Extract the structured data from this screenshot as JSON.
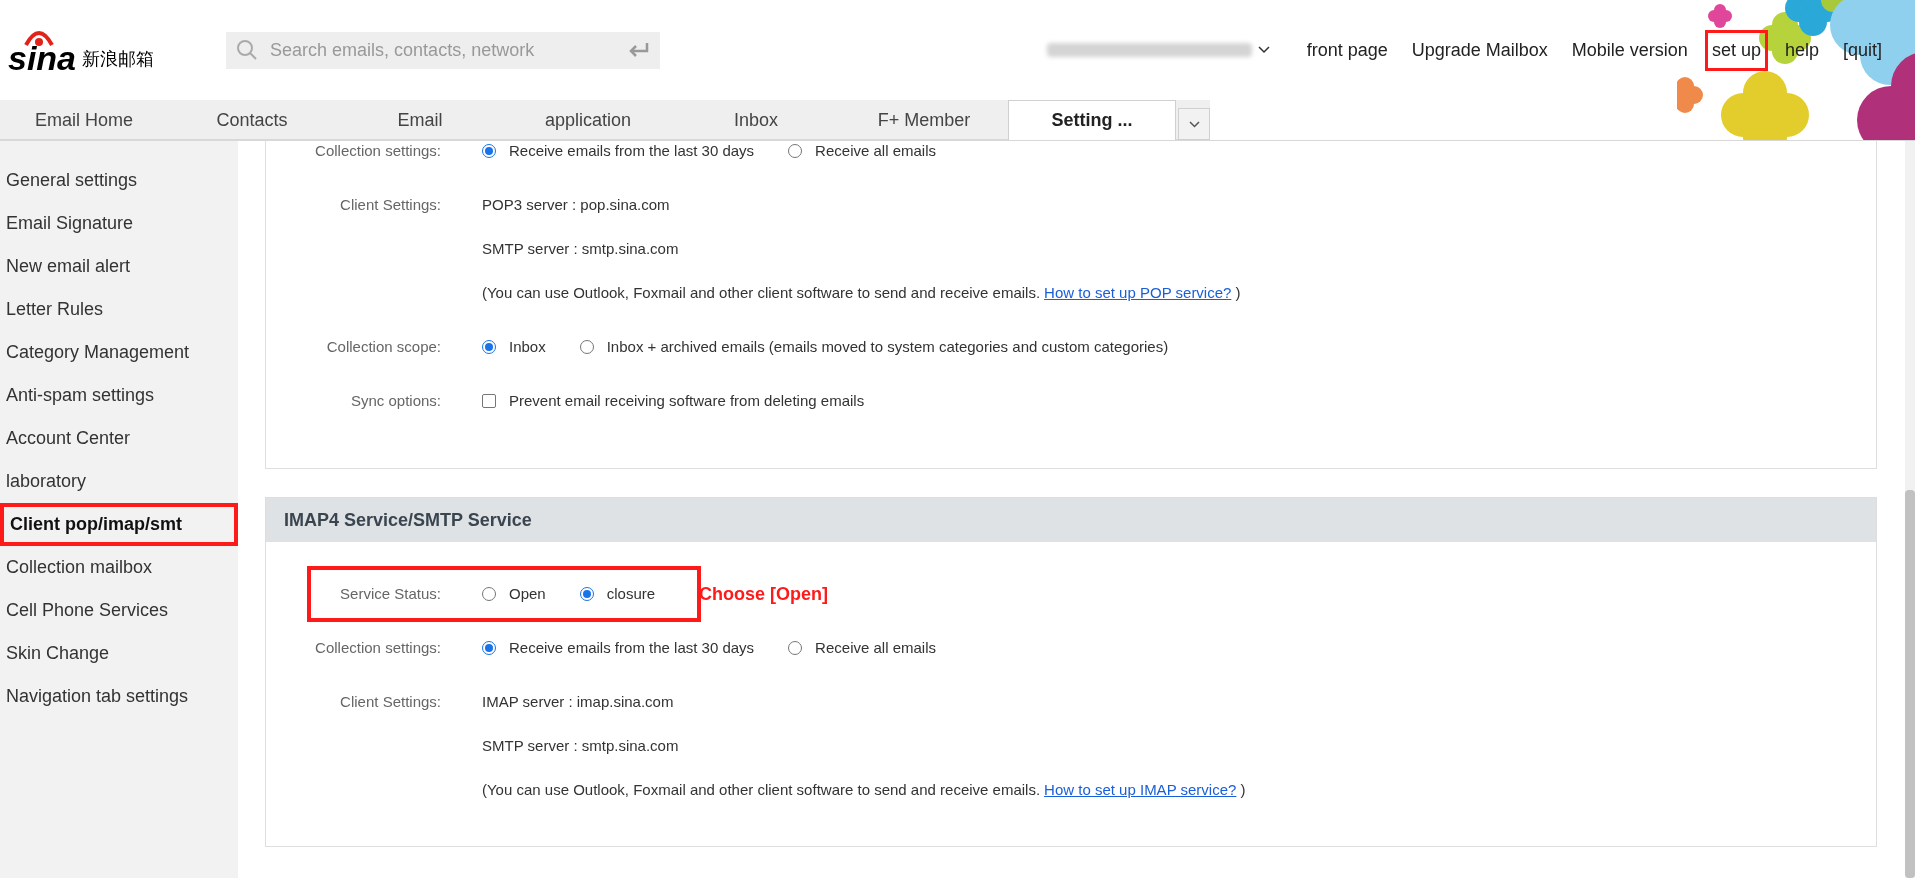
{
  "logo": {
    "wordmark": "sina",
    "name": "新浪邮箱"
  },
  "search": {
    "placeholder": "Search emails, contacts, network"
  },
  "top_links": [
    {
      "label": "front page",
      "highlighted": false
    },
    {
      "label": "Upgrade Mailbox",
      "highlighted": false
    },
    {
      "label": "Mobile version",
      "highlighted": false
    },
    {
      "label": "set up",
      "highlighted": true
    },
    {
      "label": "help",
      "highlighted": false
    },
    {
      "label": "[quit]",
      "highlighted": false
    }
  ],
  "tabs": [
    {
      "label": "Email Home",
      "selected": false
    },
    {
      "label": "Contacts",
      "selected": false
    },
    {
      "label": "Email",
      "selected": false
    },
    {
      "label": "application",
      "selected": false
    },
    {
      "label": "Inbox",
      "selected": false
    },
    {
      "label": "F+ Member",
      "selected": false
    },
    {
      "label": "Setting ...",
      "selected": true
    }
  ],
  "sidebar": {
    "items": [
      {
        "label": "General settings",
        "selected": false,
        "highlighted": false
      },
      {
        "label": "Email Signature",
        "selected": false,
        "highlighted": false
      },
      {
        "label": "New email alert",
        "selected": false,
        "highlighted": false
      },
      {
        "label": "Letter Rules",
        "selected": false,
        "highlighted": false
      },
      {
        "label": "Category Management",
        "selected": false,
        "highlighted": false
      },
      {
        "label": "Anti-spam settings",
        "selected": false,
        "highlighted": false
      },
      {
        "label": "Account Center",
        "selected": false,
        "highlighted": false
      },
      {
        "label": "laboratory",
        "selected": false,
        "highlighted": false
      },
      {
        "label": "Client pop/imap/smt",
        "selected": true,
        "highlighted": true
      },
      {
        "label": "Collection mailbox",
        "selected": false,
        "highlighted": false
      },
      {
        "label": "Cell Phone Services",
        "selected": false,
        "highlighted": false
      },
      {
        "label": "Skin Change",
        "selected": false,
        "highlighted": false
      },
      {
        "label": "Navigation tab settings",
        "selected": false,
        "highlighted": false
      }
    ]
  },
  "sections": [
    {
      "rows": [
        {
          "kind": "radio",
          "label": "Collection settings:",
          "highlighted": false,
          "options": [
            {
              "label": "Receive emails from the last 30 days",
              "selected": true
            },
            {
              "label": "Receive all emails",
              "selected": false
            }
          ]
        },
        {
          "kind": "info",
          "label": "Client Settings:",
          "lines": [
            "POP3 server : pop.sina.com",
            "SMTP server : smtp.sina.com"
          ],
          "note": {
            "text": "(You can use Outlook, Foxmail and other client software to send and receive emails.",
            "link": "How to set up POP service?",
            "suffix": ")"
          }
        },
        {
          "kind": "radio",
          "label": "Collection scope:",
          "highlighted": false,
          "options": [
            {
              "label": "Inbox",
              "selected": true
            },
            {
              "label": "Inbox + archived emails (emails moved to system categories and custom categories)",
              "selected": false
            }
          ]
        },
        {
          "kind": "checkbox",
          "label": "Sync options:",
          "option": {
            "label": "Prevent email receiving software from deleting emails",
            "checked": false
          }
        }
      ]
    },
    {
      "title": "IMAP4 Service/SMTP Service",
      "rows": [
        {
          "kind": "radio",
          "label": "Service Status:",
          "highlighted": true,
          "annotation": "Choose [Open]",
          "options": [
            {
              "label": "Open",
              "selected": false
            },
            {
              "label": "closure",
              "selected": true
            }
          ]
        },
        {
          "kind": "radio",
          "label": "Collection settings:",
          "highlighted": false,
          "options": [
            {
              "label": "Receive emails from the last 30 days",
              "selected": true
            },
            {
              "label": "Receive all emails",
              "selected": false
            }
          ]
        },
        {
          "kind": "info",
          "label": "Client Settings:",
          "lines": [
            "IMAP server : imap.sina.com",
            "SMTP server : smtp.sina.com"
          ],
          "note": {
            "text": "(You can use Outlook, Foxmail and other client software to send and receive emails.",
            "link": "How to set up IMAP service?",
            "suffix": ")"
          }
        }
      ]
    }
  ]
}
